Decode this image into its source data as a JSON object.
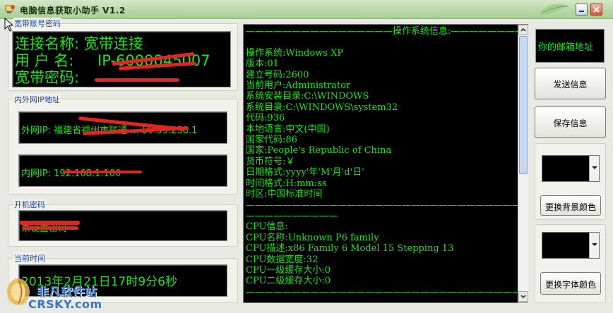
{
  "window": {
    "title": "电脑信息获取小助手  V1.2",
    "controls": [
      "minimize-icon",
      "close-icon"
    ]
  },
  "broadband": {
    "group_label": "宽带账号密码",
    "name_line": "连接名称: 宽带连接",
    "user_label": "用 户 名:",
    "user_value": "IP-6000045007",
    "password_label": "宽带密码:"
  },
  "network": {
    "group_label": "内外网IP地址",
    "external_ip": "外网IP: 福建省福州市联通 ... 59.59.238.1",
    "internal_ip": "内网IP: 192.168.1.100"
  },
  "boot": {
    "group_label": "开机密码",
    "value": "未设置密码"
  },
  "clock": {
    "group_label": "当前时间",
    "value": "2013年2月21日17时9分6秒"
  },
  "console": {
    "lines": [
      "————————————————操作系统信息:——————————",
      "",
      "操作系统:Windows XP",
      "版本:01",
      "建立号码:2600",
      "当前用户:Administrator",
      "系统安装目录:C:\\WINDOWS",
      "系统目录:C:\\WINDOWS\\system32",
      "代码:936",
      "本地语言:中文(中国)",
      "国家代码:86",
      "国家:People's Republic of China",
      "货币符号:￥",
      "日期格式:yyyy'年'M'月'd'日'",
      "时间格式:H:mm:ss",
      "时区:中国标准时间",
      "——————————————————————————————————————",
      "——————————",
      "CPU信息:",
      "CPU名称:Unknown P6 family",
      "CPU描述:x86 Family 6 Model 15 Stepping 13",
      "CPU数据宽度:32",
      "CPU一级缓存大小:0",
      "CPU二级缓存大小:0",
      "——————————————————————————————————————"
    ]
  },
  "sidebar": {
    "email_placeholder": "你的邮箱地址",
    "send_button": "发送信息",
    "save_button": "保存信息",
    "bg_color_button": "更换背景颜色",
    "font_color_button": "更换字体颜色"
  },
  "watermark": {
    "title": "非凡软件站",
    "url": "CRSKY.com"
  },
  "colors": {
    "console_text": "#1ee51e",
    "console_bg": "#000000",
    "group_label": "#1c3fa0",
    "redaction": "#e0261f"
  }
}
